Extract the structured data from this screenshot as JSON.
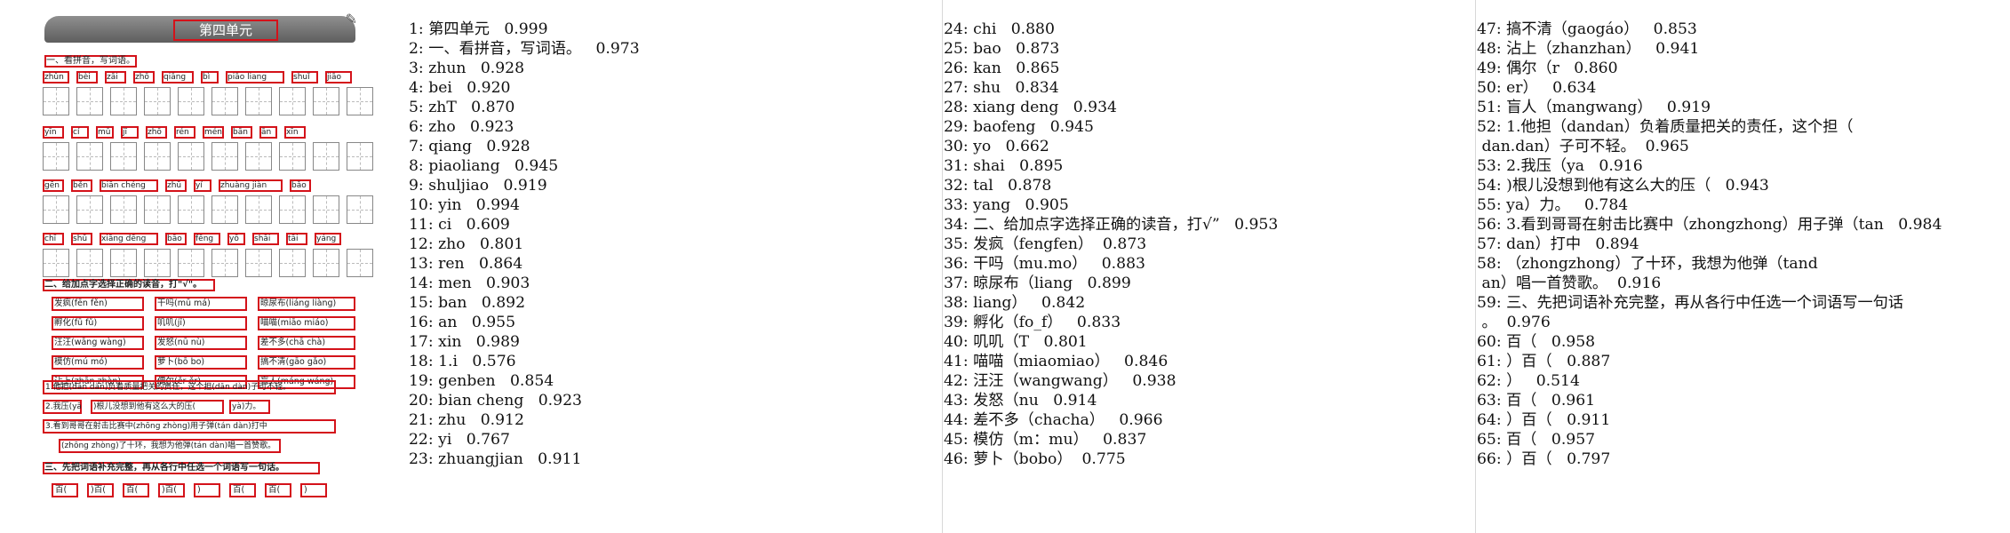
{
  "worksheet": {
    "title": "第四单元",
    "sections": [
      {
        "label": "一、看拼音，写词语。"
      },
      {
        "label": "二、给加点字选择正确的读音，打\"√\"。"
      },
      {
        "label": "三、先把词语补充完整，再从各行中任选一个词语写一句话。"
      }
    ],
    "pinyin_rows": [
      [
        "zhǔn",
        "bèi",
        "zāi",
        "zhō",
        "qiāng",
        "bì",
        "piāo liang",
        "shuǐ",
        "jiāo"
      ],
      [
        "yīn",
        "cí",
        "mǔ",
        "jī",
        "zhō",
        "rén",
        "mén",
        "bān",
        "ān",
        "xīn"
      ],
      [
        "gēn",
        "běn",
        "biān chéng",
        "zhū",
        "yí",
        "zhuàng jiàn",
        "bǎo"
      ],
      [
        "chī",
        "shū",
        "xiāng dēng",
        "bāo",
        "fēng",
        "yō",
        "shāi",
        "tāi",
        "yáng"
      ]
    ],
    "choice_rows": [
      [
        "发疯(fēn fěn)",
        "干吗(mū má)",
        "晾尿布(liáng liàng)"
      ],
      [
        "孵化(fū fǔ)",
        "叽叽(jī)",
        "喵喵(miāo miáo)"
      ],
      [
        "汪汪(wāng wàng)",
        "发怒(nū nù)",
        "差不多(chā chà)"
      ],
      [
        "模仿(mú mó)",
        "萝卜(bō bo)",
        "搞不清(gāo gǎo)"
      ],
      [
        "沾上(zhān zhàn)",
        "偶尔(ěr ěr)",
        "盲人(máng wáng)"
      ]
    ],
    "sentences": [
      "1.他担(dān dàn)负着质量把关的责任，这个担(dān dàn)子可不轻。",
      "2.我压(yā",
      ")根儿没想到他有这么大的压(",
      "yà)力。",
      "3.看到哥哥在射击比赛中(zhōng zhòng)用子弹(tán dàn)打中",
      "(zhōng zhòng)了十环，我想为他弹(tán dàn)唱一首赞歌。"
    ],
    "fill_row": [
      "百(",
      ")百(",
      "百(",
      ")百(",
      ")",
      "百(",
      "百(",
      ")"
    ]
  },
  "ocr_columns": [
    [
      "1: 第四单元   0.999",
      "2: 一、看拼音，写词语。   0.973",
      "3: zhun   0.928",
      "4: bei   0.920",
      "5: zhT   0.870",
      "6: zho   0.923",
      "7: qiang   0.928",
      "8: piaoliang   0.945",
      "9: shuljiao   0.919",
      "10: yin   0.994",
      "11: ci   0.609",
      "12: zho   0.801",
      "13: ren   0.864",
      "14: men   0.903",
      "15: ban   0.892",
      "16: an   0.955",
      "17: xin   0.989",
      "18: 1.i   0.576",
      "19: genben   0.854",
      "20: bian cheng   0.923",
      "21: zhu   0.912",
      "22: yi   0.767",
      "23: zhuangjian   0.911"
    ],
    [
      "24: chi   0.880",
      "25: bao   0.873",
      "26: kan   0.865",
      "27: shu   0.834",
      "28: xiang deng   0.934",
      "29: baofeng   0.945",
      "30: yo   0.662",
      "31: shai   0.895",
      "32: tal   0.878",
      "33: yang   0.905",
      "34: 二、给加点字选择正确的读音，打√”   0.953",
      "35: 发疯（fengfen）  0.873",
      "36: 干吗（mu.mo）   0.883",
      "37: 晾尿布（liang   0.899",
      "38: liang）   0.842",
      "39: 孵化（fo_f）   0.833",
      "40: 叽叽（T   0.801",
      "41: 喵喵（miaomiao）   0.846",
      "42: 汪汪（wangwang）   0.938",
      "43: 发怒（nu   0.914",
      "44: 差不多（chacha）   0.966",
      "45: 模仿（m：mu）   0.837",
      "46: 萝卜（bobo）  0.775"
    ],
    [
      "47: 搞不清（gaogáo）   0.853",
      "48: 沾上（zhanzhan）   0.941",
      "49: 偶尔（r   0.860",
      "50: er）   0.634",
      "51: 盲人（mangwang）   0.919",
      "52: 1.他担（dandan）负着质量把关的责任，这个担（",
      " dan.dan）子可不轻。  0.965",
      "53: 2.我压（ya   0.916",
      "54: )根儿没想到他有这么大的压（   0.943",
      "55: ya）力。   0.784",
      "56: 3.看到哥哥在射击比赛中（zhongzhong）用子弹（tan   0.984",
      "57: dan）打中   0.894",
      "58: （zhongzhong）了十环，我想为他弹（tand",
      " an）唱一首赞歌。  0.916",
      "59: 三、先把词语补充完整，再从各行中任选一个词语写一句话",
      " 。  0.976",
      "60: 百（   0.958",
      "61: ）百（   0.887",
      "62: ）   0.514",
      "63: 百（   0.961",
      "64: ）百（   0.911",
      "65: 百（   0.957",
      "66: ）百（   0.797"
    ]
  ]
}
